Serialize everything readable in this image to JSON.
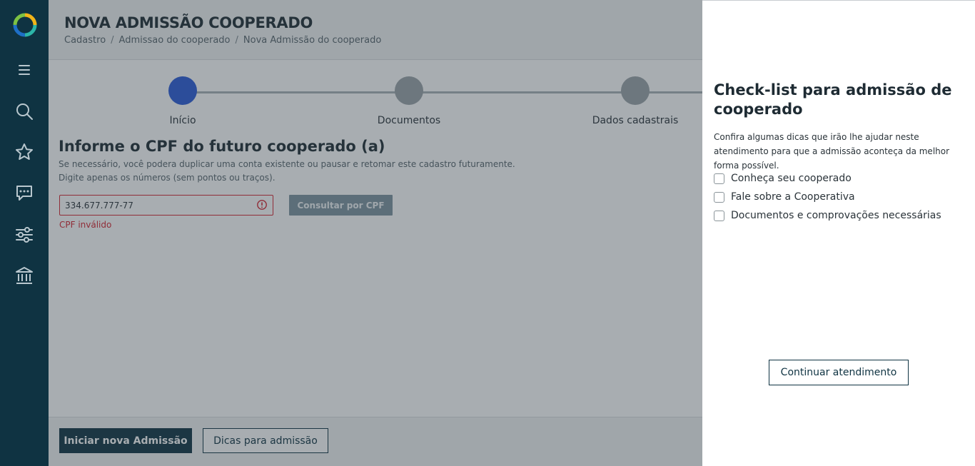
{
  "sidebar": {
    "items": [
      {
        "icon": "menu-icon"
      },
      {
        "icon": "search-icon"
      },
      {
        "icon": "star-icon"
      },
      {
        "icon": "chat-icon"
      },
      {
        "icon": "filters-icon"
      },
      {
        "icon": "bank-icon"
      }
    ]
  },
  "header": {
    "title": "NOVA ADMISSÃO COOPERADO",
    "breadcrumb": [
      "Cadastro",
      "Admissao do cooperado",
      "Nova Admissão do cooperado"
    ],
    "separator": "/"
  },
  "stepper": {
    "steps": [
      {
        "label": "Início",
        "active": true
      },
      {
        "label": "Documentos",
        "active": false
      },
      {
        "label": "Dados cadastrais",
        "active": false
      }
    ]
  },
  "form": {
    "title": "Informe o CPF do futuro cooperado (a)",
    "help_line1": "Se necessário, você podera duplicar uma conta existente ou pausar e retomar este cadastro futuramente.",
    "help_line2": "Digite apenas os números (sem pontos ou traços).",
    "cpf_value": "334.677.777-77",
    "cpf_error": "CPF inválido",
    "consult_button": "Consultar por CPF"
  },
  "footer": {
    "start_button": "Iniciar nova Admissão",
    "tips_button": "Dicas para admissão"
  },
  "panel": {
    "title": "Check-list para admissão de cooperado",
    "description": "Confira algumas dicas que irão lhe ajudar neste atendimento para que a admissão aconteça da melhor forma possível.",
    "checklist": [
      {
        "label": "Conheça seu cooperado",
        "checked": false
      },
      {
        "label": "Fale sobre a Cooperativa",
        "checked": false
      },
      {
        "label": "Documentos e comprovações necessárias",
        "checked": false
      }
    ],
    "continue_button": "Continuar atendimento"
  },
  "colors": {
    "sidebar": "#0f3342",
    "active_step": "#2a5bd7",
    "error": "#d6242f",
    "primary": "#0f3342"
  }
}
